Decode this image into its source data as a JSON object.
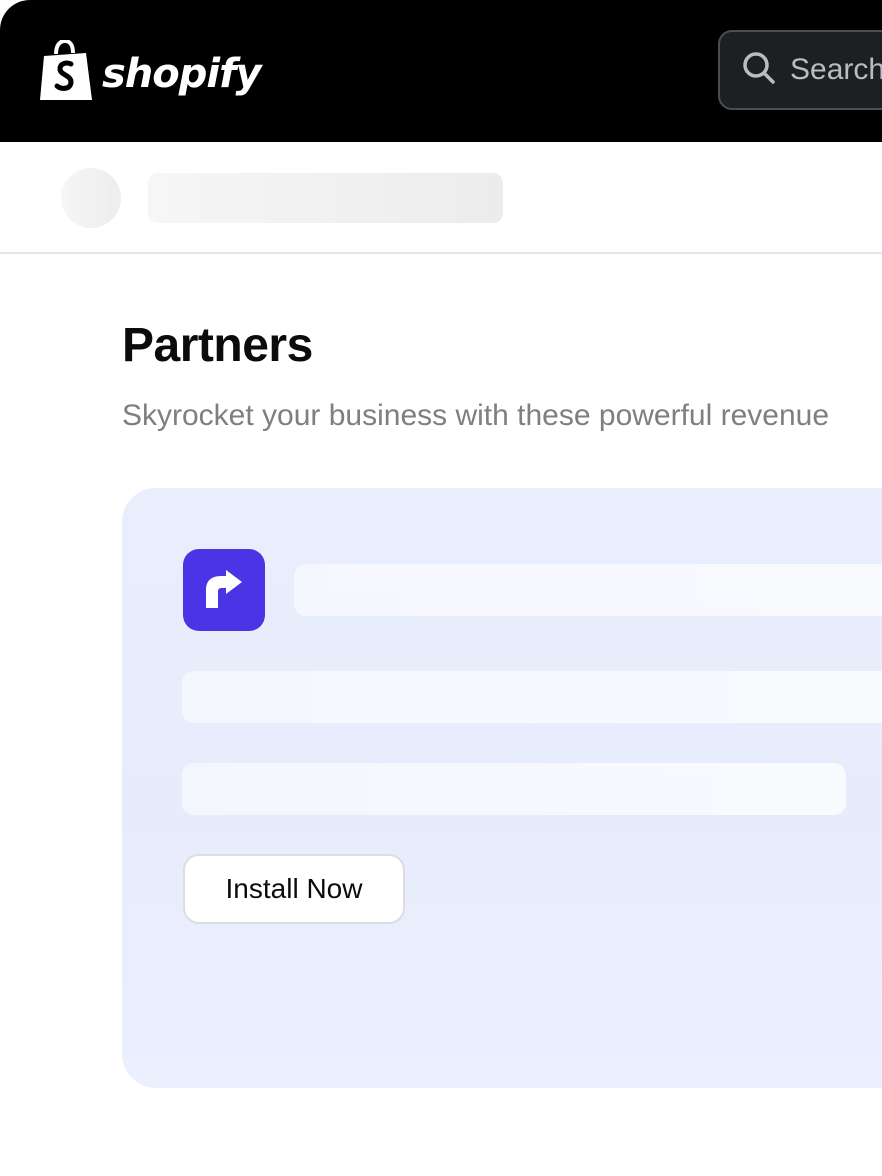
{
  "header": {
    "brand_name": "shopify",
    "brand_icon": "shopping-bag-icon",
    "search_placeholder": "Search",
    "search_icon": "search-icon"
  },
  "page": {
    "title": "Partners",
    "subtitle": "Skyrocket your business with these powerful revenue"
  },
  "partner_card": {
    "app_icon": "arrow-up-right-icon",
    "app_icon_color": "#4a35e6",
    "install_label": "Install Now"
  },
  "colors": {
    "header_bg": "#000000",
    "card_bg": "#e9eefd",
    "accent": "#4a35e6"
  }
}
